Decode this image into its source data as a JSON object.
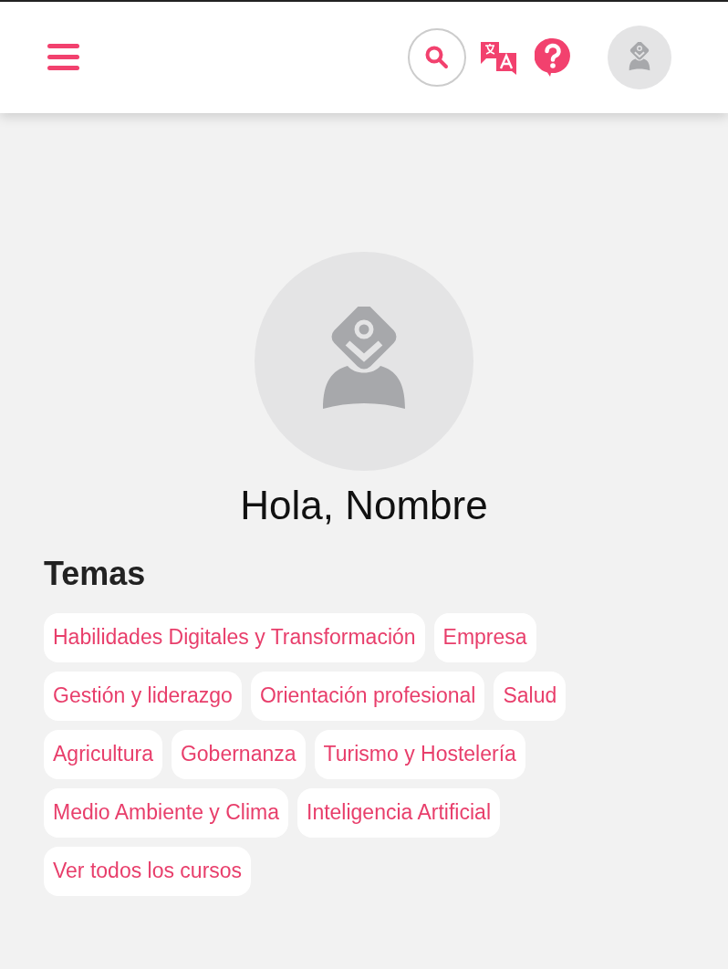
{
  "greeting": "Hola, Nombre",
  "topics": {
    "title": "Temas",
    "items": [
      {
        "label": "Habilidades Digitales y Transformación"
      },
      {
        "label": "Empresa"
      },
      {
        "label": "Gestión y liderazgo"
      },
      {
        "label": "Orientación profesional"
      },
      {
        "label": "Salud"
      },
      {
        "label": "Agricultura"
      },
      {
        "label": "Gobernanza"
      },
      {
        "label": "Turismo y Hostelería"
      },
      {
        "label": "Medio Ambiente y Clima"
      },
      {
        "label": "Inteligencia Artificial"
      },
      {
        "label": "Ver todos los cursos"
      }
    ]
  }
}
